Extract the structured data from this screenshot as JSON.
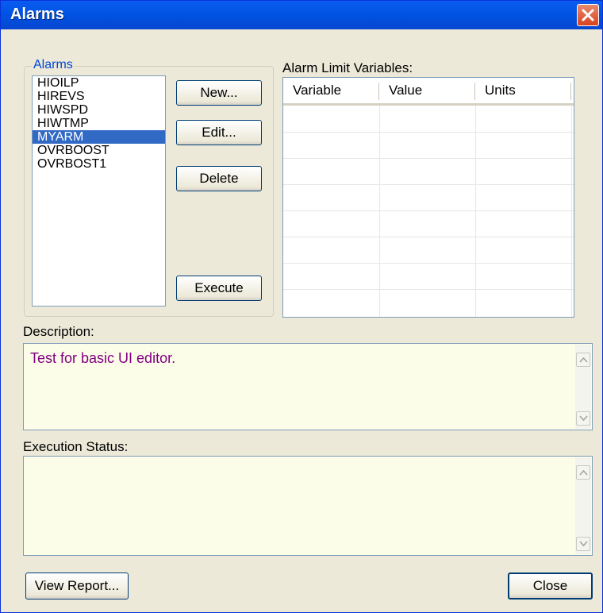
{
  "window": {
    "title": "Alarms"
  },
  "alarms": {
    "group_label": "Alarms",
    "items": [
      "HIOILP",
      "HIREVS",
      "HIWSPD",
      "HIWTMP",
      "MYARM",
      "OVRBOOST",
      "OVRBOST1"
    ],
    "selected": "MYARM"
  },
  "buttons": {
    "new": "New...",
    "edit": "Edit...",
    "delete": "Delete",
    "execute": "Execute",
    "view_report": "View Report...",
    "close": "Close"
  },
  "limits": {
    "label": "Alarm Limit Variables:",
    "columns": [
      "Variable",
      "Value",
      "Units"
    ]
  },
  "description": {
    "label": "Description:",
    "text": "Test for basic UI editor."
  },
  "execution": {
    "label": "Execution Status:",
    "text": ""
  },
  "colors": {
    "selection": "#316ac5",
    "title_bar": "#0054e3",
    "description_text": "#800080"
  }
}
